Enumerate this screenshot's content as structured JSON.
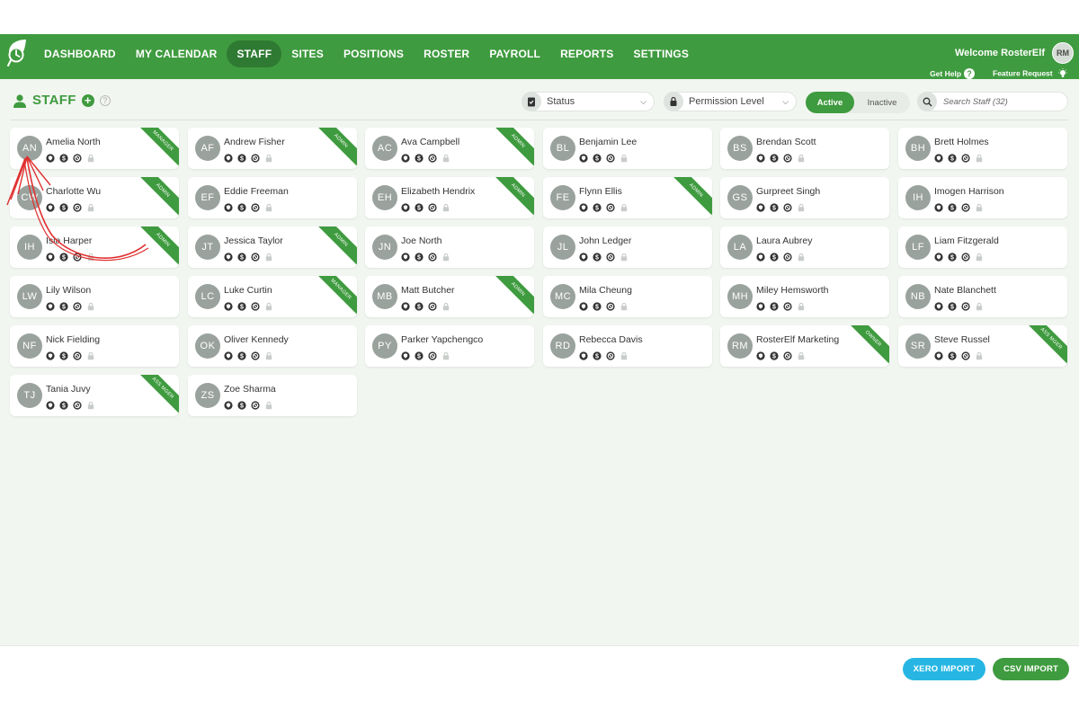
{
  "nav": {
    "items": [
      "DASHBOARD",
      "MY CALENDAR",
      "STAFF",
      "SITES",
      "POSITIONS",
      "ROSTER",
      "PAYROLL",
      "REPORTS",
      "SETTINGS"
    ],
    "active": "STAFF",
    "welcome": "Welcome RosterElf",
    "user_initials": "RM",
    "help": "Get Help",
    "feature": "Feature Request"
  },
  "toolbar": {
    "title": "STAFF",
    "status_label": "Status",
    "permission_label": "Permission Level",
    "active_label": "Active",
    "inactive_label": "Inactive",
    "search_placeholder": "Search Staff (32)"
  },
  "staff": [
    {
      "initials": "AN",
      "name": "Amelia North",
      "badge": "MANAGER"
    },
    {
      "initials": "AF",
      "name": "Andrew Fisher",
      "badge": "ADMIN"
    },
    {
      "initials": "AC",
      "name": "Ava Campbell",
      "badge": "ADMIN"
    },
    {
      "initials": "BL",
      "name": "Benjamin Lee",
      "badge": ""
    },
    {
      "initials": "BS",
      "name": "Brendan Scott",
      "badge": ""
    },
    {
      "initials": "BH",
      "name": "Brett Holmes",
      "badge": ""
    },
    {
      "initials": "CW",
      "name": "Charlotte Wu",
      "badge": "ADMIN"
    },
    {
      "initials": "EF",
      "name": "Eddie Freeman",
      "badge": ""
    },
    {
      "initials": "EH",
      "name": "Elizabeth Hendrix",
      "badge": "ADMIN"
    },
    {
      "initials": "FE",
      "name": "Flynn Ellis",
      "badge": "ADMIN"
    },
    {
      "initials": "GS",
      "name": "Gurpreet Singh",
      "badge": ""
    },
    {
      "initials": "IH",
      "name": "Imogen Harrison",
      "badge": ""
    },
    {
      "initials": "IH",
      "name": "Isla Harper",
      "badge": "ADMIN"
    },
    {
      "initials": "JT",
      "name": "Jessica Taylor",
      "badge": "ADMIN"
    },
    {
      "initials": "JN",
      "name": "Joe North",
      "badge": ""
    },
    {
      "initials": "JL",
      "name": "John Ledger",
      "badge": ""
    },
    {
      "initials": "LA",
      "name": "Laura Aubrey",
      "badge": ""
    },
    {
      "initials": "LF",
      "name": "Liam Fitzgerald",
      "badge": ""
    },
    {
      "initials": "LW",
      "name": "Lily Wilson",
      "badge": ""
    },
    {
      "initials": "LC",
      "name": "Luke Curtin",
      "badge": "MANAGER"
    },
    {
      "initials": "MB",
      "name": "Matt Butcher",
      "badge": "ADMIN"
    },
    {
      "initials": "MC",
      "name": "Mila Cheung",
      "badge": ""
    },
    {
      "initials": "MH",
      "name": "Miley Hemsworth",
      "badge": ""
    },
    {
      "initials": "NB",
      "name": "Nate Blanchett",
      "badge": ""
    },
    {
      "initials": "NF",
      "name": "Nick Fielding",
      "badge": ""
    },
    {
      "initials": "OK",
      "name": "Oliver Kennedy",
      "badge": ""
    },
    {
      "initials": "PY",
      "name": "Parker Yapchengco",
      "badge": ""
    },
    {
      "initials": "RD",
      "name": "Rebecca Davis",
      "badge": ""
    },
    {
      "initials": "RM",
      "name": "RosterElf Marketing",
      "badge": "OWNER"
    },
    {
      "initials": "SR",
      "name": "Steve Russel",
      "badge": "ASS MGER"
    },
    {
      "initials": "TJ",
      "name": "Tania Juvy",
      "badge": "ASS MGER"
    },
    {
      "initials": "ZS",
      "name": "Zoe Sharma",
      "badge": ""
    }
  ],
  "footer": {
    "xero_label": "XERO IMPORT",
    "csv_label": "CSV IMPORT"
  },
  "colors": {
    "brand_green": "#3f9b3f",
    "xero_blue": "#27b6e3"
  }
}
